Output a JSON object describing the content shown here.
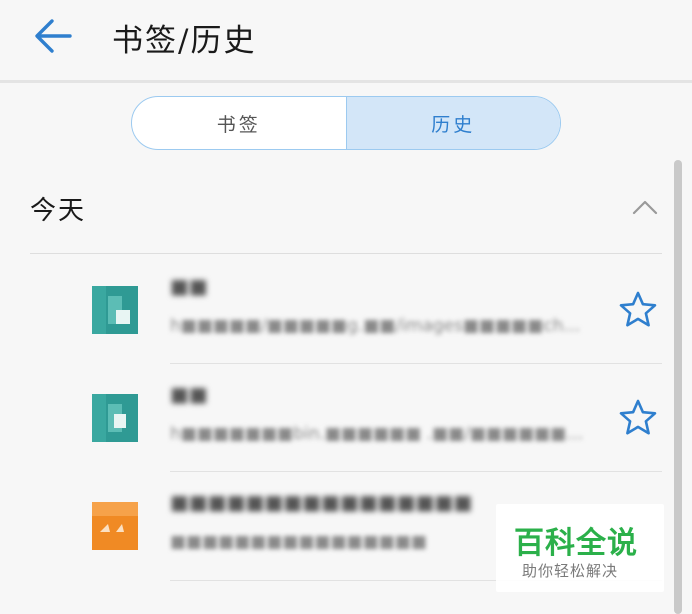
{
  "header": {
    "title": "书签/历史",
    "back_icon": "arrow-left-icon"
  },
  "tabs": [
    {
      "label": "书签",
      "active": false
    },
    {
      "label": "历史",
      "active": true
    }
  ],
  "section": {
    "title": "今天",
    "toggle_icon": "chevron-up-icon"
  },
  "history": [
    {
      "title": "■■",
      "url": "h■■■■■/■■■■■g.■■/images■■■■■ch■■■■■ …",
      "favicon_color": "#2f9a94",
      "starred": false
    },
    {
      "title": "■■",
      "url": "h■■■■■■■bin.■■■■■■ .■■/■■■■■■■■■ …",
      "favicon_color": "#2f9a94",
      "starred": false
    },
    {
      "title": "■■■■■■■■■■■■■■■■",
      "url": "■■■■■■■■■■■■■■■■",
      "favicon_color": "#f08a24",
      "starred": false
    }
  ],
  "watermark": {
    "brand": "百科全说",
    "tagline": "助你轻松解决"
  },
  "colors": {
    "accent": "#2f7fce",
    "active_tab_bg": "#d3e6f8",
    "watermark_green": "#2bb04a"
  }
}
